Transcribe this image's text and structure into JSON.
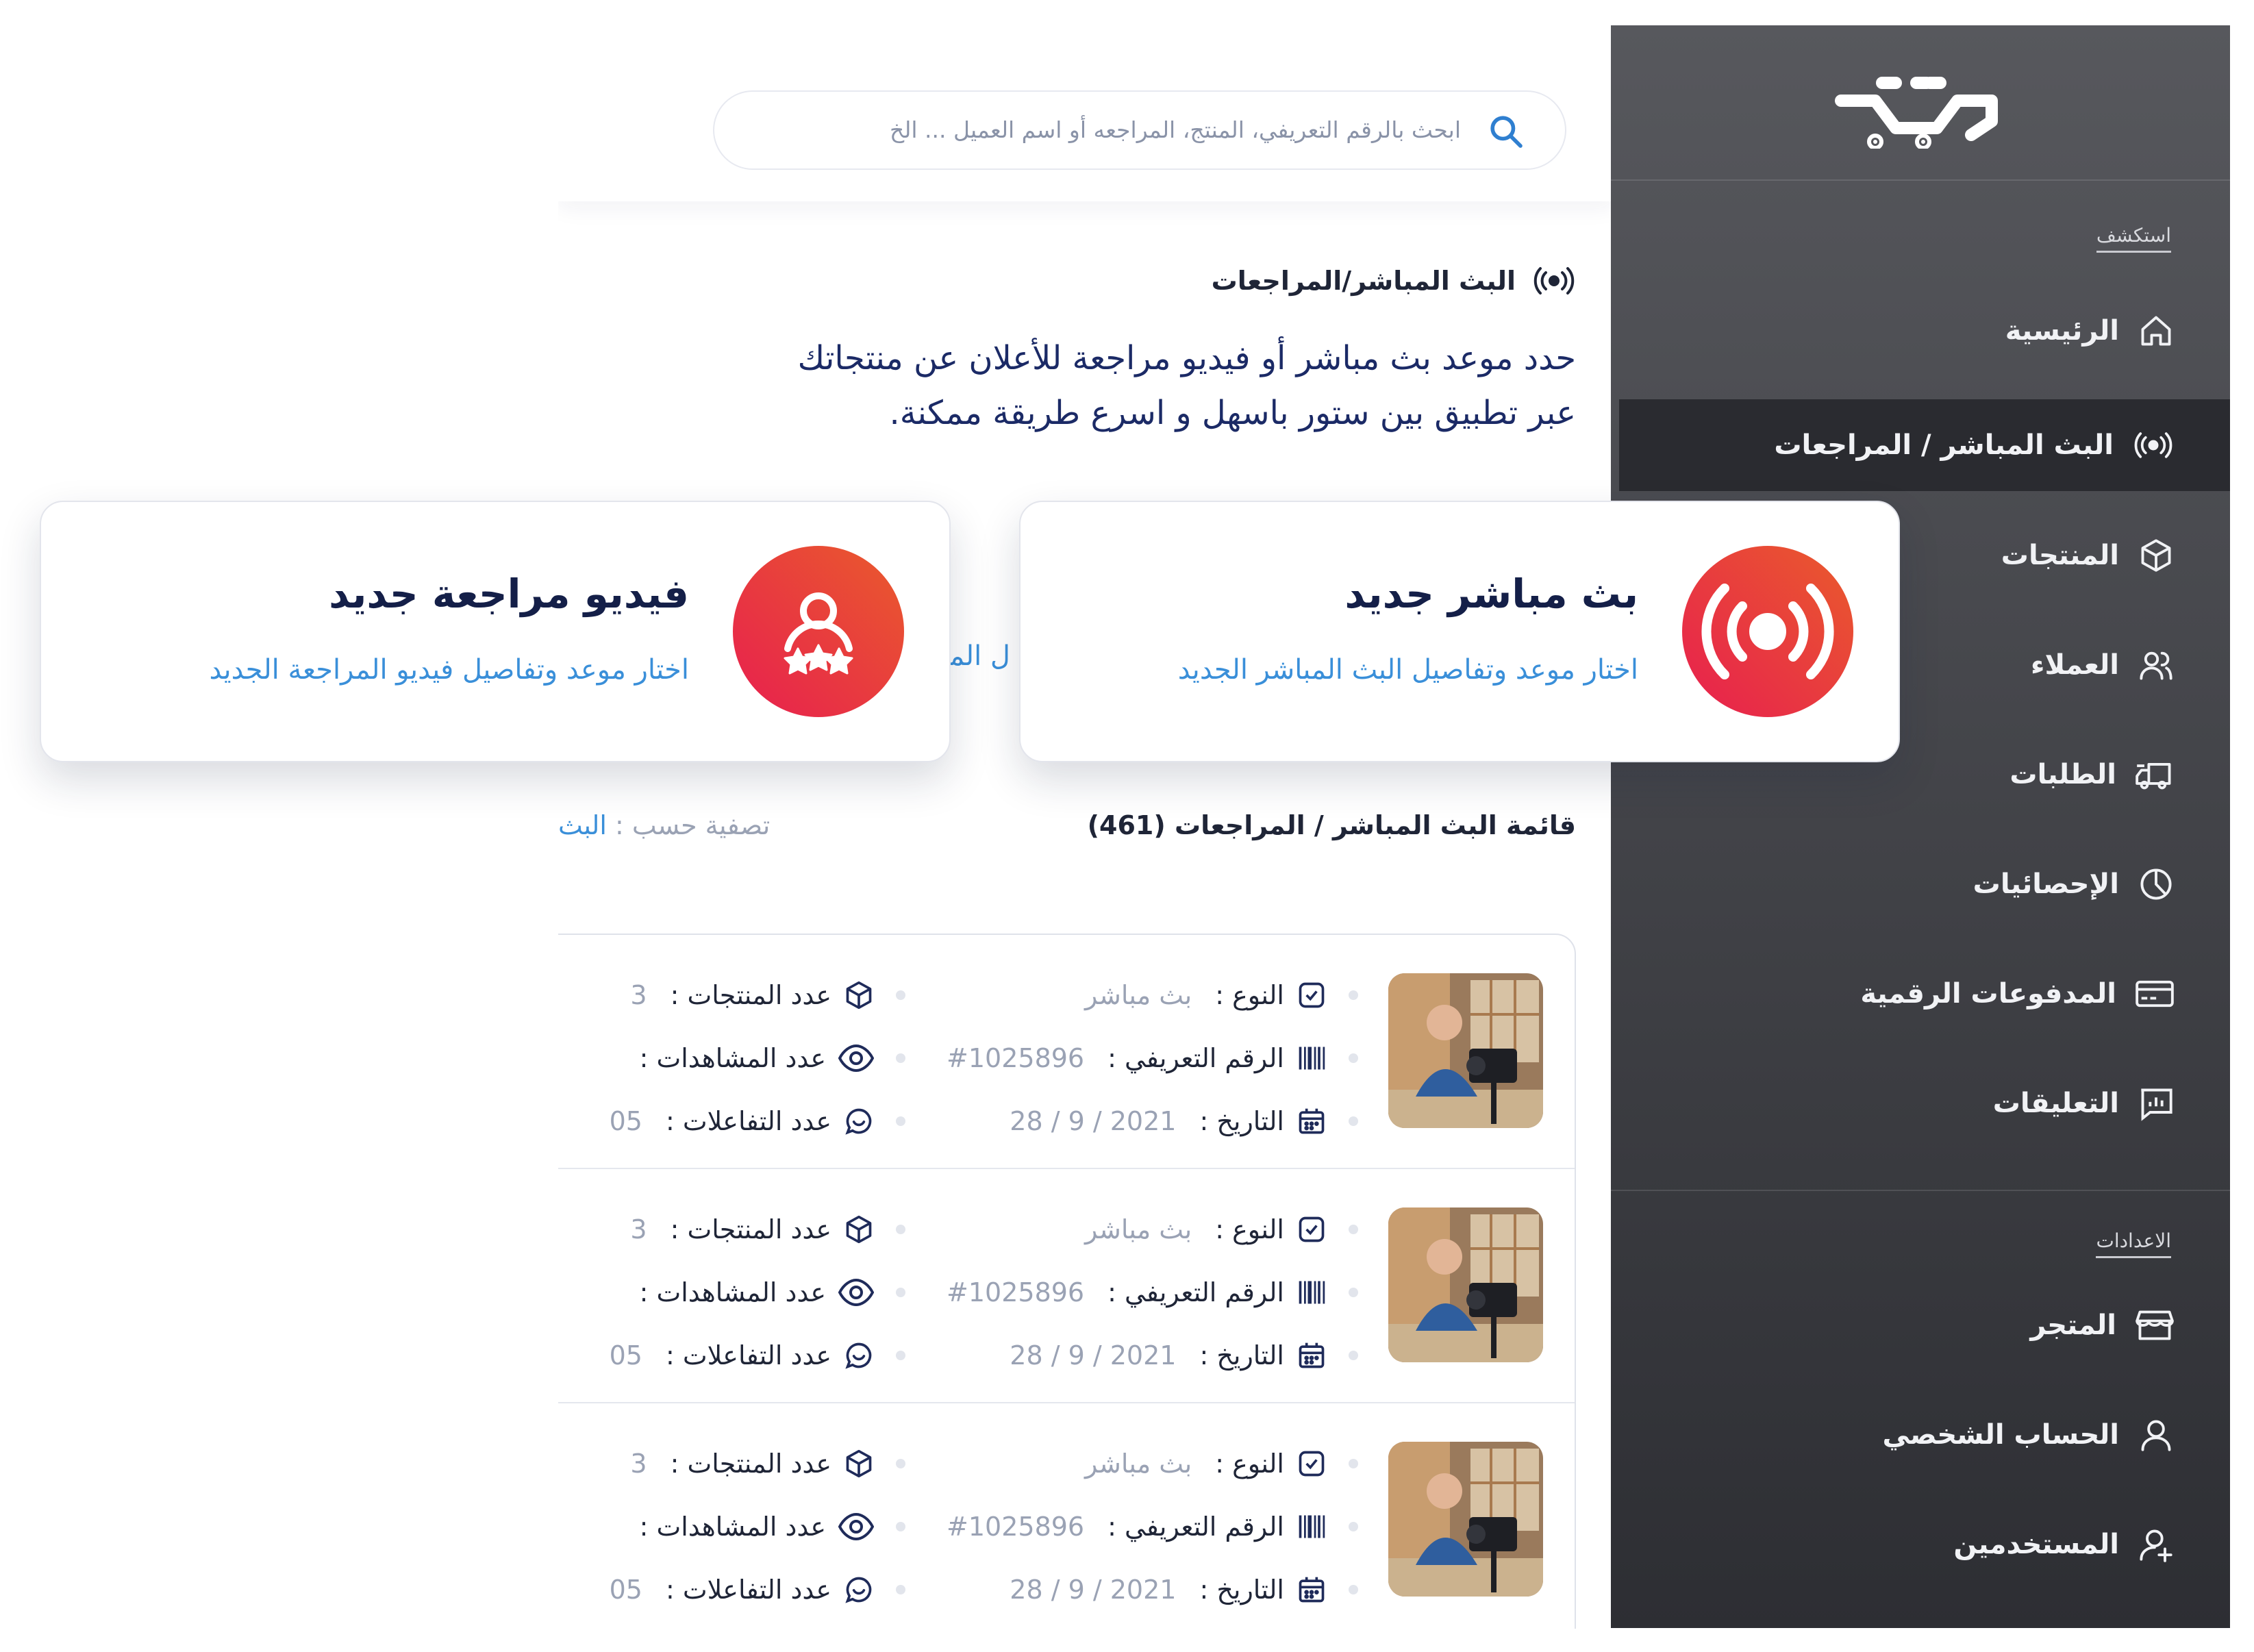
{
  "search": {
    "placeholder": "ابحث بالرقم التعريفي، المنتج، المراجعه أو اسم العميل ... الخ"
  },
  "page": {
    "heading": "البث المباشر/المراجعات",
    "intro_line1": "حدد موعد بث مباشر أو فيديو مراجعة للأعلان عن منتجاتك",
    "intro_line2": "عبر تطبيق بين ستور باسهل و اسرع طريقة ممكنة."
  },
  "cards": {
    "live": {
      "title": "بث مباشر جديد",
      "subtitle": "اختار موعد وتفاصيل البث المباشر الجديد",
      "icon": "broadcast-icon"
    },
    "review": {
      "title": "فيديو مراجعة جديد",
      "subtitle": "اختار موعد وتفاصيل فيديو المراجعة الجديد",
      "icon": "user-rating-icon"
    }
  },
  "card_peek": "ل المب",
  "list": {
    "title": "قائمة البث المباشر / المراجعات (461)",
    "filter_label": "تصفية حسب :",
    "filter_value": "البث",
    "labels": {
      "type": "النوع :",
      "id": "الرقم التعريفي :",
      "date": "التاريخ :",
      "products": "عدد المنتجات :",
      "views": "عدد المشاهدات :",
      "interactions": "عدد التفاعلات :"
    },
    "rows": [
      {
        "type": "بث مباشر",
        "id": "#1025896",
        "date": "2021 / 9 / 28",
        "products": "3",
        "views": "",
        "interactions": "05"
      },
      {
        "type": "بث مباشر",
        "id": "#1025896",
        "date": "2021 / 9 / 28",
        "products": "3",
        "views": "",
        "interactions": "05"
      },
      {
        "type": "بث مباشر",
        "id": "#1025896",
        "date": "2021 / 9 / 28",
        "products": "3",
        "views": "",
        "interactions": "05"
      }
    ]
  },
  "sidebar": {
    "logo": "بين",
    "explore_label": "استكشف",
    "settings_label": "الاعدادات",
    "active_item": "البث المباشر / المراجعات",
    "items": [
      {
        "label": "الرئيسية",
        "icon": "home-icon"
      },
      {
        "label": "البث المباشر / المراجعات",
        "icon": "broadcast-icon"
      },
      {
        "label": "المنتجات",
        "icon": "box-icon"
      },
      {
        "label": "العملاء",
        "icon": "users-icon"
      },
      {
        "label": "الطلبات",
        "icon": "delivery-truck-icon"
      },
      {
        "label": "الإحصائيات",
        "icon": "pie-chart-icon"
      },
      {
        "label": "المدفوعات الرقمية",
        "icon": "credit-card-icon"
      },
      {
        "label": "التعليقات",
        "icon": "comment-chart-icon"
      }
    ],
    "settings_items": [
      {
        "label": "المتجر",
        "icon": "store-icon"
      },
      {
        "label": "الحساب الشخصي",
        "icon": "user-icon"
      },
      {
        "label": "المستخدمين",
        "icon": "user-add-icon"
      }
    ]
  },
  "colors": {
    "sidebar_top": "#57585d",
    "sidebar_bottom": "#2d2e33",
    "accent_blue": "#3a8fd9",
    "gradient_red": "#e81f4f",
    "gradient_orange": "#e95b2c",
    "navy_text": "#1b2a66"
  }
}
